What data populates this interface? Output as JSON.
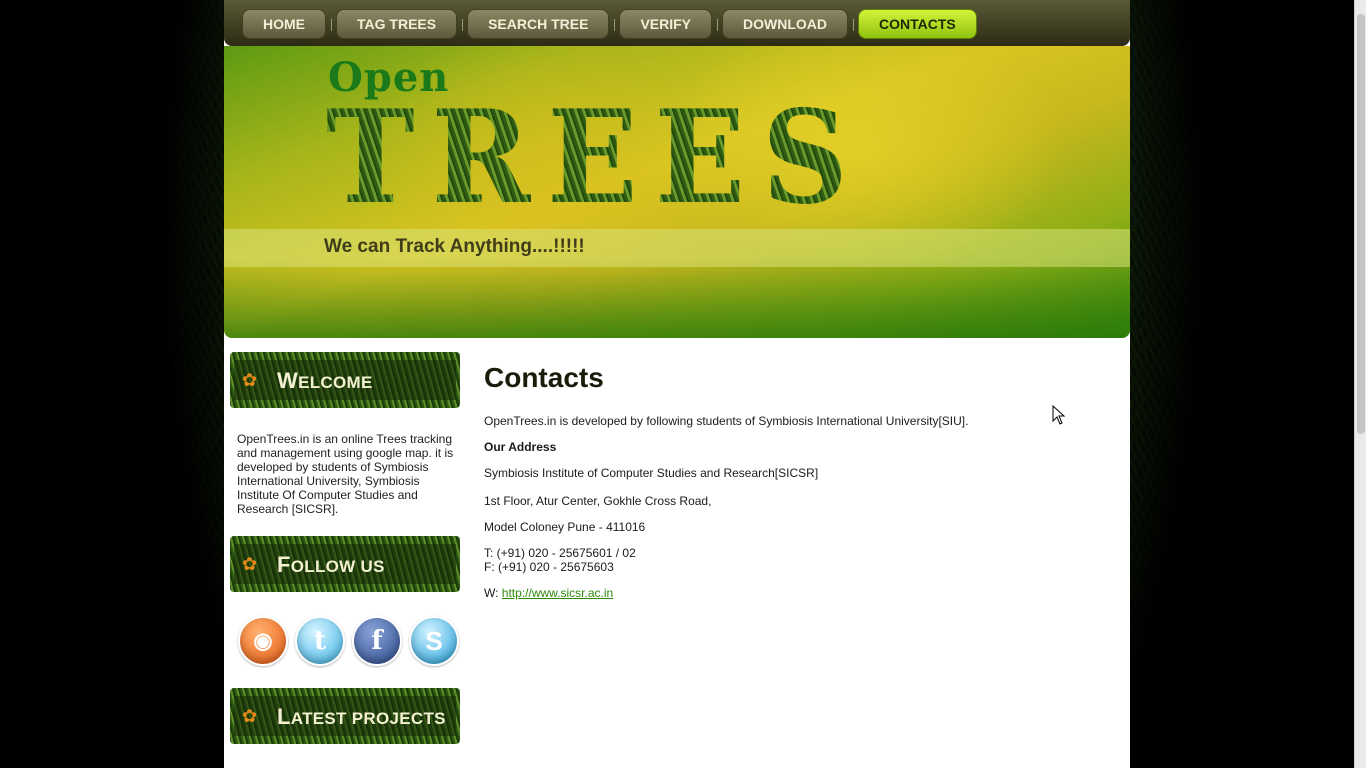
{
  "nav": {
    "items": [
      {
        "label": "HOME",
        "name": "nav-home"
      },
      {
        "label": "TAG TREES",
        "name": "nav-tag-trees"
      },
      {
        "label": "SEARCH TREE",
        "name": "nav-search-tree"
      },
      {
        "label": "VERIFY",
        "name": "nav-verify"
      },
      {
        "label": "DOWNLOAD",
        "name": "nav-download"
      },
      {
        "label": "CONTACTS",
        "name": "nav-contacts",
        "active": true
      }
    ]
  },
  "header": {
    "logo_open": "Open",
    "logo_trees": "TREES",
    "tagline": "We can Track Anything....!!!!!"
  },
  "sidebar": {
    "welcome_title_cap": "W",
    "welcome_title_rest": "ELCOME",
    "welcome_text": "OpenTrees.in is an online Trees tracking and management using google map. it is developed by students of Symbiosis International University, Symbiosis Institute Of Computer Studies and Research [SICSR].",
    "follow_title_cap": "F",
    "follow_title_rest": "OLLOW US",
    "social": [
      {
        "name": "rss-icon",
        "glyph": "◉"
      },
      {
        "name": "twitter-icon",
        "glyph": "t"
      },
      {
        "name": "facebook-icon",
        "glyph": "f"
      },
      {
        "name": "skype-icon",
        "glyph": "S"
      }
    ],
    "latest_title_cap": "L",
    "latest_title_rest": "ATEST PROJECTS"
  },
  "main": {
    "title": "Contacts",
    "intro": "OpenTrees.in is developed by following students of Symbiosis International University[SIU].",
    "address_heading": "Our Address",
    "line1": "Symbiosis Institute of Computer Studies and Research[SICSR]",
    "line2": "1st Floor, Atur Center, Gokhle Cross Road,",
    "line3": "Model Coloney Pune - 411016",
    "phone": "T: (+91) 020 - 25675601 / 02",
    "fax": "F: (+91) 020 - 25675603",
    "web_prefix": "W:",
    "web_link": "http://www.sicsr.ac.in"
  },
  "colors": {
    "nav_active": "#b8e11f",
    "link": "#2f8a0c",
    "header_yellow": "#d9c522"
  }
}
